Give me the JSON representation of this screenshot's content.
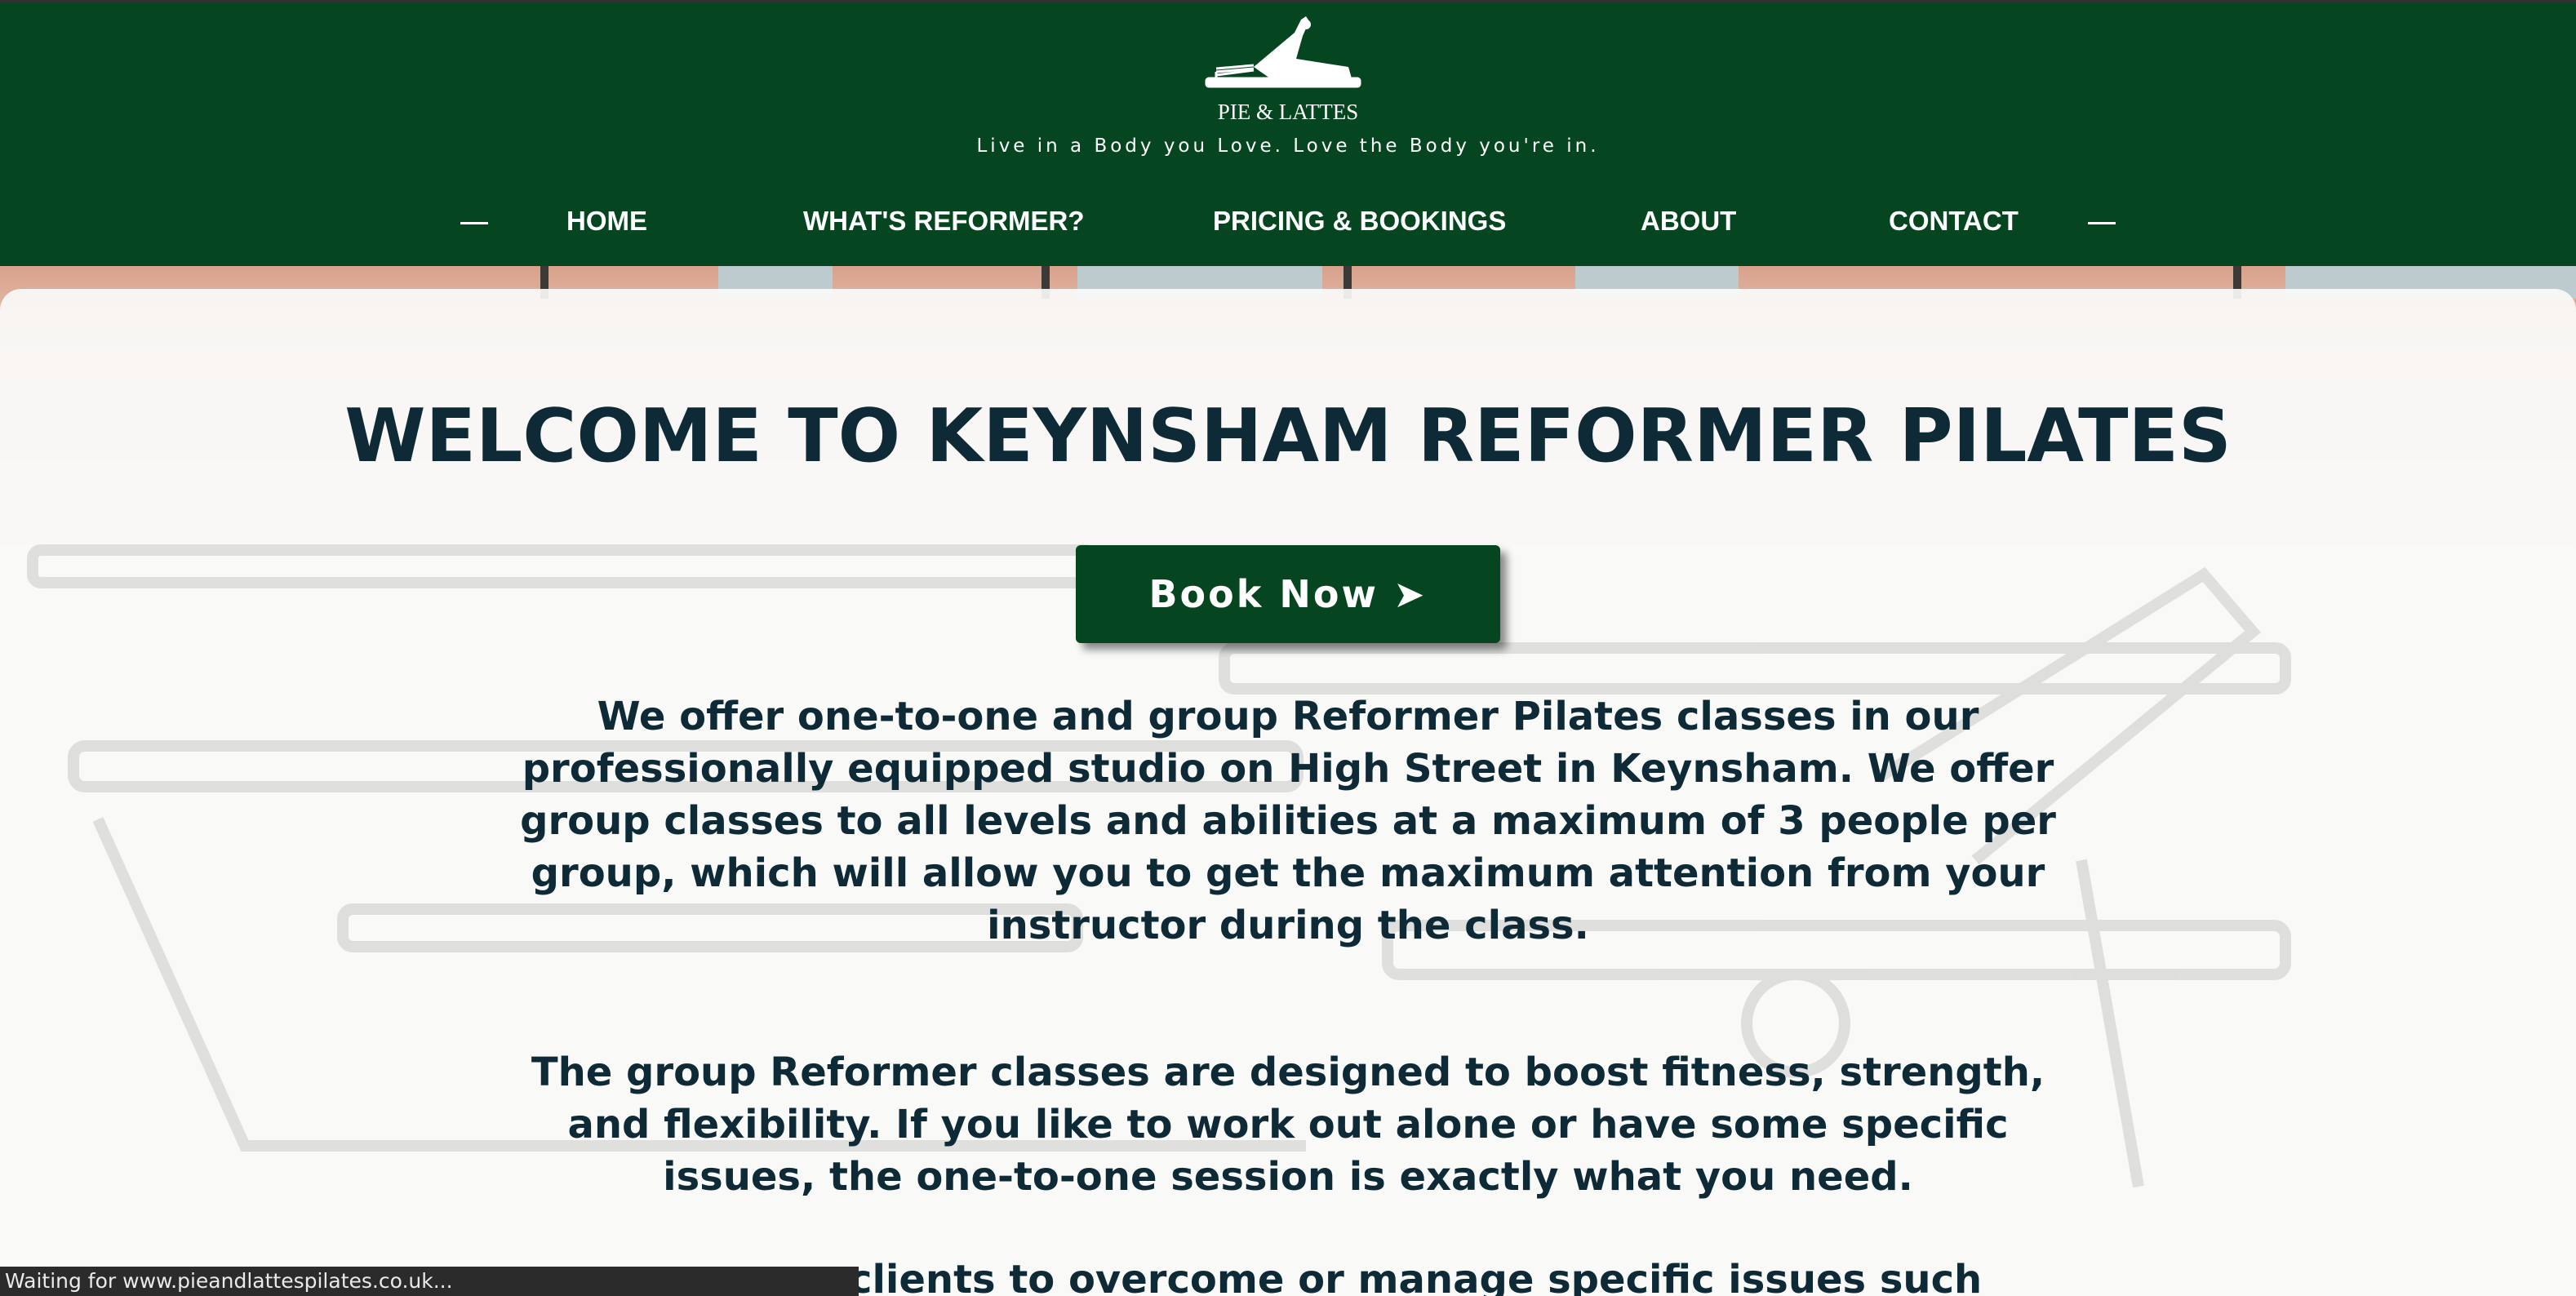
{
  "site": {
    "brand": "PIE & LATTES",
    "tagline": "Live in a Body you Love. Love the Body you're in."
  },
  "nav": {
    "items": [
      {
        "label": "HOME"
      },
      {
        "label": "WHAT'S REFORMER?"
      },
      {
        "label": "PRICING & BOOKINGS"
      },
      {
        "label": "ABOUT"
      },
      {
        "label": "CONTACT"
      }
    ]
  },
  "hero": {
    "heading": "WELCOME TO KEYNSHAM REFORMER PILATES",
    "book_button": {
      "label": "Book Now",
      "arrow": "➤"
    },
    "paragraph_1": "We offer one-to-one and group Reformer Pilates classes in our professionally equipped studio on High Street in Keynsham. We offer group classes to all levels and abilities at a maximum of 3 people per group, which will allow you to get the maximum attention from your instructor during the class.",
    "paragraph_2": "The group Reformer classes are designed to boost fitness, strength, and flexibility. If you like to work out alone or have some specific issues, the one-to-one session is exactly what you need.",
    "paragraph_3_partial": "clients to overcome or manage specific issues such as:"
  },
  "status_bar": {
    "text": "Waiting for www.pieandlattespilates.co.uk..."
  },
  "colors": {
    "header_bg": "#054621",
    "heading_text": "#0d2a36",
    "button_bg": "#054621",
    "status_bg": "#2b2b2b"
  },
  "icons": {
    "logo": "pilates-reformer-logo-icon",
    "book_arrow": "arrow-right-icon"
  }
}
